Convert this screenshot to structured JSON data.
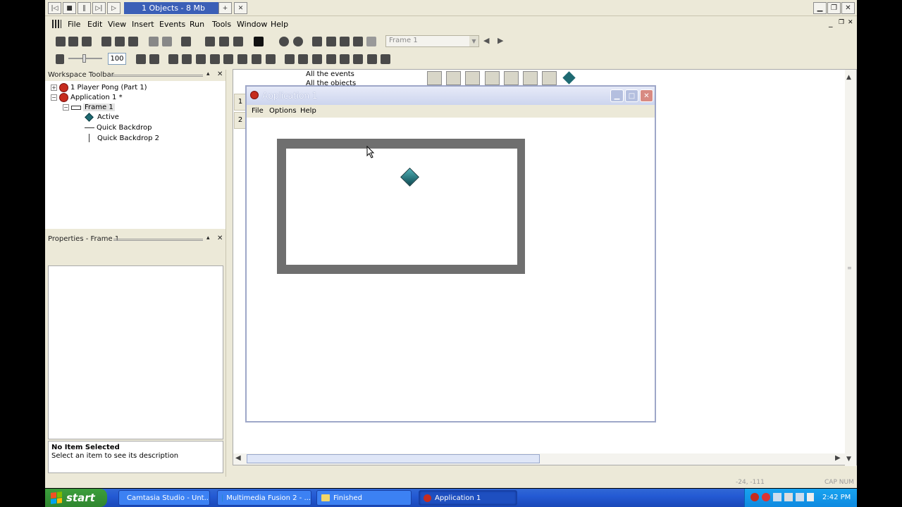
{
  "titlebar": {
    "status": "1 Objects - 8 Mb"
  },
  "menu": [
    "File",
    "Edit",
    "View",
    "Insert",
    "Events",
    "Run",
    "Tools",
    "Window",
    "Help"
  ],
  "toolbar": {
    "frame_combo": "Frame 1",
    "zoom": "100"
  },
  "workspace": {
    "title": "Workspace Toolbar",
    "items": [
      {
        "label": "1 Player Pong (Part 1)"
      },
      {
        "label": "Application 1 *"
      },
      {
        "label": "Frame 1"
      },
      {
        "label": "Active"
      },
      {
        "label": "Quick Backdrop"
      },
      {
        "label": "Quick Backdrop 2"
      }
    ]
  },
  "properties": {
    "title": "Properties - Frame 1",
    "desc_title": "No Item Selected",
    "desc_text": "Select an item to see its description"
  },
  "event_editor": {
    "header1": "All the events",
    "header2": "All the objects",
    "rows": [
      "1",
      "2"
    ]
  },
  "child_window": {
    "title": "Application 1",
    "menu": [
      "File",
      "Options",
      "Help"
    ]
  },
  "statusbar": {
    "coords": "-24, -111",
    "indicators": "CAP  NUM"
  },
  "taskbar": {
    "start": "start",
    "tasks": [
      "Camtasia Studio - Unt...",
      "Multimedia Fusion 2 - ...",
      "Finished",
      "Application 1"
    ],
    "clock": "2:42 PM"
  }
}
